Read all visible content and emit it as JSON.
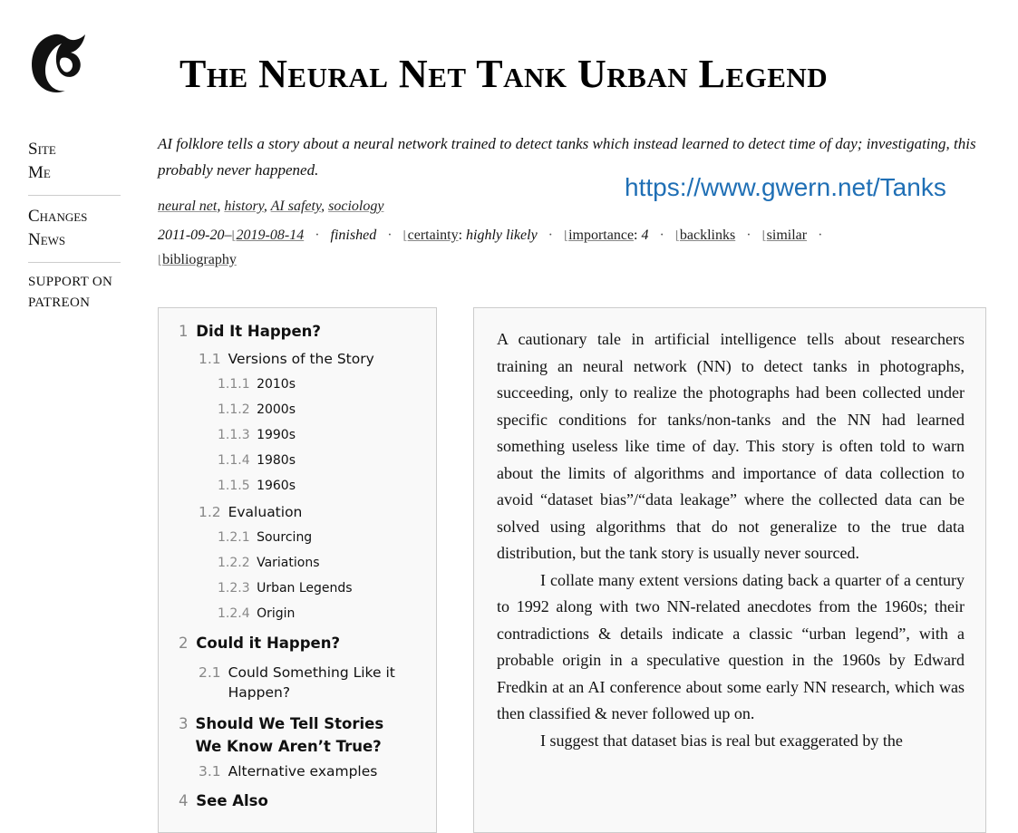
{
  "page": {
    "title": "The Neural Net Tank Urban Legend"
  },
  "logo": {
    "glyph": "G"
  },
  "nav": {
    "site": "Site",
    "me": "Me",
    "changes": "Changes",
    "news": "News",
    "support": "Support on Patreon"
  },
  "description": "AI folklore tells a story about a neural network trained to detect tanks which instead learned to detect time of day; investigating, this probably never happened.",
  "url": "https://www.gwern.net/Tanks",
  "tags": [
    "neural net",
    "history",
    "AI safety",
    "sociology"
  ],
  "meta": {
    "created": "2011-09-20",
    "dash": "–",
    "modified": "2019-08-14",
    "status": "finished",
    "certainty_label": "certainty",
    "certainty_value": "highly likely",
    "importance_label": "importance",
    "importance_value": "4",
    "backlinks": "backlinks",
    "similar": "similar",
    "bibliography": "bibliography"
  },
  "toc": {
    "items": [
      {
        "num": "1",
        "label": "Did It Happen?"
      },
      {
        "num": "1.1",
        "label": "Versions of the Story"
      },
      {
        "num": "1.1.1",
        "label": "2010s"
      },
      {
        "num": "1.1.2",
        "label": "2000s"
      },
      {
        "num": "1.1.3",
        "label": "1990s"
      },
      {
        "num": "1.1.4",
        "label": "1980s"
      },
      {
        "num": "1.1.5",
        "label": "1960s"
      },
      {
        "num": "1.2",
        "label": "Evaluation"
      },
      {
        "num": "1.2.1",
        "label": "Sourcing"
      },
      {
        "num": "1.2.2",
        "label": "Variations"
      },
      {
        "num": "1.2.3",
        "label": "Urban Legends"
      },
      {
        "num": "1.2.4",
        "label": "Origin"
      },
      {
        "num": "2",
        "label": "Could it Happen?"
      },
      {
        "num": "2.1",
        "label": "Could Something Like it Happen?"
      },
      {
        "num": "3",
        "label": "Should We Tell Stories We Know Aren’t True?"
      },
      {
        "num": "3.1",
        "label": "Alternative examples"
      },
      {
        "num": "4",
        "label": "See Also"
      }
    ]
  },
  "article": {
    "paragraphs": [
      "A cautionary tale in artificial intelligence tells about researchers training an neural network (NN) to detect tanks in photographs, succeeding, only to realize the photographs had been collected under specific conditions for tanks/non-tanks and the NN had learned something useless like time of day. This story is often told to warn about the limits of algorithms and importance of data collection to avoid “dataset bias”/“data leakage” where the collected data can be solved using algorithms that do not generalize to the true data distribution, but the tank story is usually never sourced.",
      "I collate many extent versions dating back a quarter of a century to 1992 along with two NN-related anecdotes from the 1960s; their contradictions & details indicate a classic “urban legend”, with a probable origin in a speculative question in the 1960s by Edward Fredkin at an AI conference about some early NN research, which was then classified & never followed up on.",
      "I suggest that dataset bias is real but exaggerated by the"
    ]
  }
}
